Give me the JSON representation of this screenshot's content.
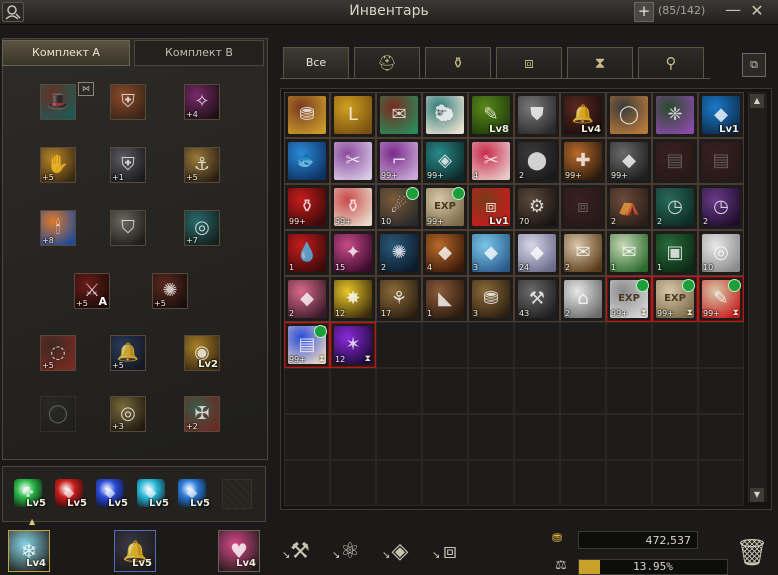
{
  "window": {
    "title": "Инвентарь",
    "capacity": "(85/142)",
    "expand_icon": "plus-icon",
    "minimize_icon": "minimize-icon",
    "close_icon": "close-icon",
    "character_icon": "character-search-icon"
  },
  "kit_tabs": [
    "Комплект A",
    "Комплект B"
  ],
  "equipment": {
    "active_kit": "Комплект A",
    "slots": [
      {
        "name": "hat",
        "c1": "#6a2e22",
        "c2": "#1c5a55",
        "glyph": "🎩",
        "count": "",
        "lv": ""
      },
      {
        "name": "armor-plate",
        "c1": "#8a4a2a",
        "c2": "#3a2418",
        "glyph": "⛨",
        "count": "",
        "lv": ""
      },
      {
        "name": "feather-back",
        "c1": "#7a2a6a",
        "c2": "#1c1016",
        "glyph": "✧",
        "count": "+4",
        "lv": ""
      },
      {
        "name": "gloves",
        "c1": "#b8862a",
        "c2": "#3a2a12",
        "glyph": "✋",
        "count": "+5",
        "lv": ""
      },
      {
        "name": "chest-armor",
        "c1": "#5a5a60",
        "c2": "#1a1a1e",
        "glyph": "⛨",
        "count": "+1",
        "lv": ""
      },
      {
        "name": "boots",
        "c1": "#9a7a3a",
        "c2": "#2a1e12",
        "glyph": "⚓",
        "count": "+5",
        "lv": ""
      },
      {
        "name": "candle-lamp",
        "c1": "#e07a2a",
        "c2": "#1e4a9a",
        "glyph": "🕯",
        "count": "+8",
        "lv": ""
      },
      {
        "name": "leggings",
        "c1": "#6a6a60",
        "c2": "#201c18",
        "glyph": "⛉",
        "count": "",
        "lv": ""
      },
      {
        "name": "amulet",
        "c1": "#2a6a6a",
        "c2": "#14201e",
        "glyph": "◎",
        "count": "+7",
        "lv": ""
      },
      {
        "name": "sword",
        "c1": "#6a1c18",
        "c2": "#1a0c0a",
        "glyph": "⚔",
        "count": "+5",
        "lv": "",
        "tag": "A"
      },
      {
        "name": "staff",
        "c1": "#5a2a20",
        "c2": "#1a0e0c",
        "glyph": "✺",
        "count": "+5",
        "lv": ""
      },
      {
        "name": "ring-left",
        "c1": "#3a2a22",
        "c2": "#7a2a22",
        "glyph": "◌",
        "count": "+5",
        "lv": ""
      },
      {
        "name": "bell-wing",
        "c1": "#2a3a5a",
        "c2": "#141820",
        "glyph": "🔔",
        "count": "+5",
        "lv": ""
      },
      {
        "name": "eye-ring",
        "c1": "#a8802a",
        "c2": "#3a2a10",
        "glyph": "◉",
        "count": "",
        "lv": "Lv2"
      },
      {
        "name": "ring-dim",
        "c1": "#3a3a3a",
        "c2": "#1a1a1a",
        "glyph": "◯",
        "count": "",
        "lv": "",
        "dim": true
      },
      {
        "name": "belt-ring",
        "c1": "#7a6a3a",
        "c2": "#1e1a10",
        "glyph": "◎",
        "count": "+3",
        "lv": ""
      },
      {
        "name": "shield-crest",
        "c1": "#3a5a4a",
        "c2": "#6a2a22",
        "glyph": "✠",
        "count": "+2",
        "lv": ""
      }
    ]
  },
  "gems": [
    {
      "color": "#2ab84a",
      "glyph": "✤",
      "lv": "Lv5"
    },
    {
      "color": "#c81c1c",
      "glyph": "◆",
      "lv": "Lv5"
    },
    {
      "color": "#2a4ad8",
      "glyph": "◆",
      "lv": "Lv5"
    },
    {
      "color": "#2ab8d8",
      "glyph": "◆",
      "lv": "Lv5"
    },
    {
      "color": "#2a7ad8",
      "glyph": "◆",
      "lv": "Lv5"
    }
  ],
  "inventory_tabs": [
    {
      "label": "Все",
      "icon": ""
    },
    {
      "label": "",
      "icon": "helmet-icon"
    },
    {
      "label": "",
      "icon": "potion-icon"
    },
    {
      "label": "",
      "icon": "box-icon"
    },
    {
      "label": "",
      "icon": "hourglass-icon"
    },
    {
      "label": "",
      "icon": "stamp-icon"
    }
  ],
  "inventory_tab_glyphs": [
    "",
    "⛑",
    "⚱",
    "⧈",
    "⧗",
    "⚲"
  ],
  "inventory": {
    "columns": 10,
    "rows": 9,
    "items": [
      {
        "c1": "#7a3a20",
        "c2": "#c89a2a",
        "g": "⛃",
        "cnt": "",
        "lv": ""
      },
      {
        "c1": "#d0a020",
        "c2": "#7a5010",
        "g": "L",
        "cnt": "",
        "lv": ""
      },
      {
        "c1": "#7a2a20",
        "c2": "#2a8a5a",
        "g": "✉",
        "cnt": "",
        "lv": ""
      },
      {
        "c1": "#2a7a7a",
        "c2": "#e8e0d0",
        "g": "🐑",
        "cnt": "",
        "lv": ""
      },
      {
        "c1": "#5a8a1a",
        "c2": "#1e3a0c",
        "g": "✎",
        "cnt": "",
        "lv": "Lv8"
      },
      {
        "c1": "#7a7a7a",
        "c2": "#2a2a2a",
        "g": "⛊",
        "cnt": "",
        "lv": ""
      },
      {
        "c1": "#5a2a22",
        "c2": "#1a0c0a",
        "g": "🔔",
        "cnt": "",
        "lv": "Lv4"
      },
      {
        "c1": "#3a3a3a",
        "c2": "#b87a3a",
        "g": "◯",
        "cnt": "",
        "lv": ""
      },
      {
        "c1": "#2a4a2a",
        "c2": "#8a4aa8",
        "g": "❈",
        "cnt": "",
        "lv": ""
      },
      {
        "c1": "#1a7ac8",
        "c2": "#0c2a4a",
        "g": "◆",
        "cnt": "",
        "lv": "Lv1"
      },
      {
        "c1": "#2a8ad8",
        "c2": "#0c3060",
        "g": "🐟",
        "cnt": "",
        "lv": ""
      },
      {
        "c1": "#8a4a9a",
        "c2": "#d8c8e8",
        "g": "✂",
        "cnt": "",
        "lv": ""
      },
      {
        "c1": "#7a2a8a",
        "c2": "#c8a8d8",
        "g": "⌐",
        "cnt": "99+",
        "lv": ""
      },
      {
        "c1": "#2a8a8a",
        "c2": "#0c2a2a",
        "g": "◈",
        "cnt": "99+",
        "lv": ""
      },
      {
        "c1": "#c82a4a",
        "c2": "#e8c8c8",
        "g": "✂",
        "cnt": "4",
        "lv": ""
      },
      {
        "c1": "#3a3a3a",
        "c2": "#1a1a1a",
        "g": "⬤",
        "cnt": "2",
        "lv": ""
      },
      {
        "c1": "#b86a2a",
        "c2": "#2a1a0c",
        "g": "✚",
        "cnt": "99+",
        "lv": ""
      },
      {
        "c1": "#6a6a6a",
        "c2": "#1e1e1e",
        "g": "◆",
        "cnt": "99+",
        "lv": ""
      },
      {
        "c1": "#6a2a2a",
        "c2": "#3a1414",
        "g": "▤",
        "cnt": "",
        "lv": "",
        "faded": true
      },
      {
        "c1": "#6a2a2a",
        "c2": "#3a1414",
        "g": "▤",
        "cnt": "",
        "lv": "",
        "faded": true
      },
      {
        "c1": "#c81c1c",
        "c2": "#3a0a0a",
        "g": "⚱",
        "cnt": "99+",
        "lv": ""
      },
      {
        "c1": "#c84a4a",
        "c2": "#e8d8c8",
        "g": "⚱",
        "cnt": "99+",
        "lv": ""
      },
      {
        "c1": "#7a5a3a",
        "c2": "#2a2a2a",
        "g": "☄",
        "cnt": "10",
        "lv": "",
        "exp": true
      },
      {
        "c1": "#d8c8a8",
        "c2": "#7a6a4a",
        "g": "EXP",
        "cnt": "99+",
        "lv": "",
        "exp": true
      },
      {
        "c1": "#7a3a1a",
        "c2": "#c81c1c",
        "g": "⧈",
        "cnt": "",
        "lv": "Lv1"
      },
      {
        "c1": "#5a4a3a",
        "c2": "#1a1410",
        "g": "⚙",
        "cnt": "70",
        "lv": ""
      },
      {
        "c1": "#6a2a2a",
        "c2": "#3a1414",
        "g": "⧈",
        "cnt": "",
        "lv": "",
        "faded": true
      },
      {
        "c1": "#6a4a3a",
        "c2": "#2a1e18",
        "g": "⛺",
        "cnt": "2",
        "lv": ""
      },
      {
        "c1": "#2a6a5a",
        "c2": "#0c2a24",
        "g": "◷",
        "cnt": "2",
        "lv": ""
      },
      {
        "c1": "#6a3a8a",
        "c2": "#1e0e2a",
        "g": "◷",
        "cnt": "2",
        "lv": ""
      },
      {
        "c1": "#c81c1c",
        "c2": "#3a0a0a",
        "g": "💧",
        "cnt": "1",
        "lv": ""
      },
      {
        "c1": "#c84a8a",
        "c2": "#3a0a2a",
        "g": "✦",
        "cnt": "15",
        "lv": ""
      },
      {
        "c1": "#2a5a7a",
        "c2": "#0c1a2a",
        "g": "✺",
        "cnt": "2",
        "lv": ""
      },
      {
        "c1": "#b86a2a",
        "c2": "#3a1a0a",
        "g": "◆",
        "cnt": "4",
        "lv": ""
      },
      {
        "c1": "#7ac8e8",
        "c2": "#2a5a8a",
        "g": "◆",
        "cnt": "3",
        "lv": ""
      },
      {
        "c1": "#d8d8e8",
        "c2": "#6a6a8a",
        "g": "◆",
        "cnt": "24",
        "lv": ""
      },
      {
        "c1": "#d8c8a8",
        "c2": "#5a3a1a",
        "g": "✉",
        "cnt": "2",
        "lv": ""
      },
      {
        "c1": "#c8d8b8",
        "c2": "#2a6a2a",
        "g": "✉",
        "cnt": "1",
        "lv": ""
      },
      {
        "c1": "#2a6a3a",
        "c2": "#0c2a14",
        "g": "▣",
        "cnt": "1",
        "lv": ""
      },
      {
        "c1": "#e8e8e8",
        "c2": "#8a8a8a",
        "g": "◎",
        "cnt": "10",
        "lv": ""
      },
      {
        "c1": "#d86a8a",
        "c2": "#3a1a2a",
        "g": "◆",
        "cnt": "2",
        "lv": ""
      },
      {
        "c1": "#e8c82a",
        "c2": "#3a2a0a",
        "g": "✸",
        "cnt": "12",
        "lv": ""
      },
      {
        "c1": "#8a6a3a",
        "c2": "#2a1e10",
        "g": "⚘",
        "cnt": "17",
        "lv": ""
      },
      {
        "c1": "#8a5a3a",
        "c2": "#2a1a0c",
        "g": "◣",
        "cnt": "1",
        "lv": ""
      },
      {
        "c1": "#8a6a3a",
        "c2": "#2a1e10",
        "g": "⛃",
        "cnt": "3",
        "lv": ""
      },
      {
        "c1": "#6a6a6a",
        "c2": "#1e1e1e",
        "g": "⚒",
        "cnt": "43",
        "lv": ""
      },
      {
        "c1": "#e8e8e8",
        "c2": "#6a6a6a",
        "g": "⌂",
        "cnt": "2",
        "lv": ""
      },
      {
        "c1": "#8a8a8a",
        "c2": "#d8d8d8",
        "g": "EXP",
        "cnt": "99+",
        "lv": "",
        "exp": true,
        "red": true,
        "timer": true
      },
      {
        "c1": "#d8c8a8",
        "c2": "#7a6a4a",
        "g": "EXP",
        "cnt": "99+",
        "lv": "",
        "exp": true,
        "red": true,
        "timer": true
      },
      {
        "c1": "#d8c8a8",
        "c2": "#c81c1c",
        "g": "✎",
        "cnt": "99+",
        "lv": "",
        "exp": true,
        "red": true,
        "timer": true
      },
      {
        "c1": "#2a4ad8",
        "c2": "#e8d8c8",
        "g": "▤",
        "cnt": "99+",
        "lv": "",
        "exp": true,
        "red": true,
        "timer": true
      },
      {
        "c1": "#8a2ad8",
        "c2": "#1e0a3a",
        "g": "✶",
        "cnt": "12",
        "lv": "",
        "red": true,
        "timer": true
      }
    ]
  },
  "bottom_slots": [
    {
      "name": "crystal-flower",
      "color": "#8ad8e8",
      "glyph": "❄",
      "lv": "Lv4",
      "border": "#c8a040"
    },
    {
      "name": "bell-charm",
      "color": "#3a3a4a",
      "glyph": "🔔",
      "lv": "Lv5",
      "border": "#5a6ab8"
    },
    {
      "name": "heart-ring",
      "color": "#d84a8a",
      "glyph": "♥",
      "lv": "Lv4",
      "border": "#6a6150"
    }
  ],
  "tools": [
    {
      "name": "dismantle-anvil-icon",
      "glyph": "⚒"
    },
    {
      "name": "atom-enchant-icon",
      "glyph": "⚛"
    },
    {
      "name": "crystal-refine-icon",
      "glyph": "◈"
    },
    {
      "name": "chest-storage-icon",
      "glyph": "⧈"
    }
  ],
  "currency": {
    "gold_icon": "gold-coins-icon",
    "gold": "472,537",
    "weight_icon": "weight-icon",
    "weight_percent_value": 13.95,
    "weight_text": "13.95%",
    "fill_color": "#c9a12a"
  },
  "trash_icon": "trash-icon"
}
